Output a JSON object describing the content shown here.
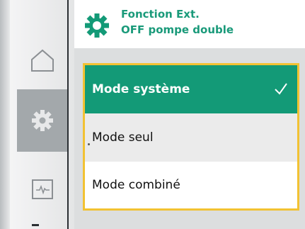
{
  "header": {
    "title_line1": "Fonction Ext.",
    "title_line2": "OFF pompe double",
    "icon": "gear-icon",
    "accent": "#1a9a7a"
  },
  "sidebar": {
    "items": [
      {
        "icon": "home-icon"
      },
      {
        "icon": "gear-icon",
        "active": true
      },
      {
        "icon": "trend-icon"
      }
    ]
  },
  "menu": {
    "items": [
      {
        "label": "Mode système",
        "selected": true
      },
      {
        "label": "Mode seul",
        "selected": false
      },
      {
        "label": "Mode combiné",
        "selected": false
      }
    ],
    "selected_color": "#139a77",
    "focus_border": "#f2c233"
  }
}
